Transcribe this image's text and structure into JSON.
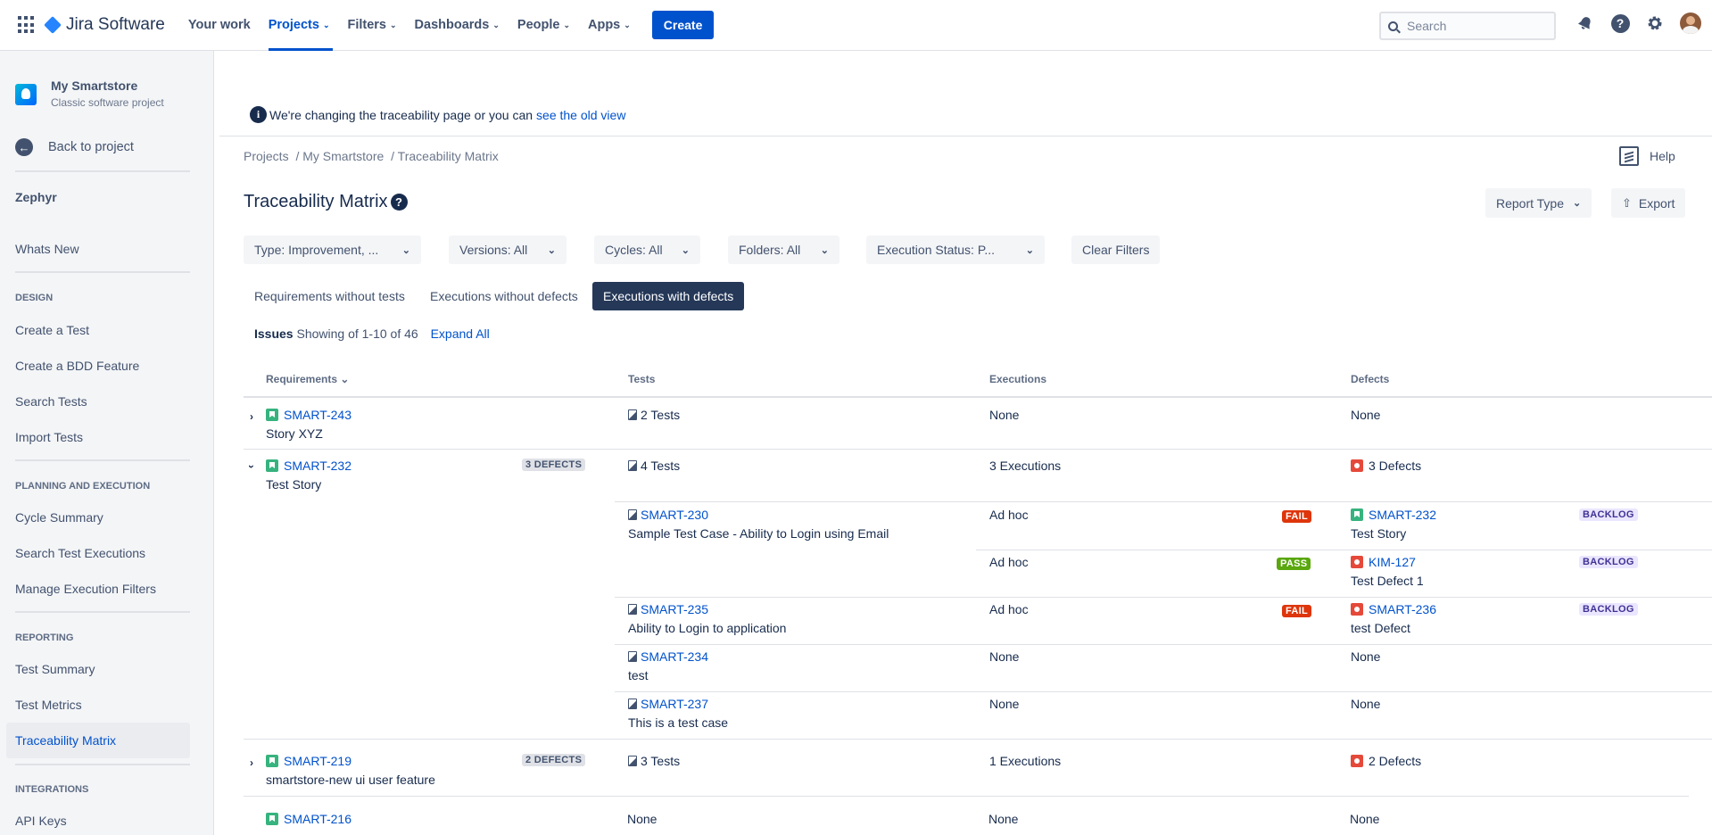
{
  "topnav": {
    "product": "Jira Software",
    "items": [
      {
        "label": "Your work",
        "chevron": false
      },
      {
        "label": "Projects",
        "chevron": true,
        "active": true
      },
      {
        "label": "Filters",
        "chevron": true
      },
      {
        "label": "Dashboards",
        "chevron": true
      },
      {
        "label": "People",
        "chevron": true
      },
      {
        "label": "Apps",
        "chevron": true
      }
    ],
    "create": "Create",
    "search_placeholder": "Search"
  },
  "sidebar": {
    "project_name": "My Smartstore",
    "project_type": "Classic software project",
    "back": "Back to project",
    "app": "Zephyr",
    "whats_new": "Whats New",
    "design": "DESIGN",
    "create_test": "Create a Test",
    "create_bdd": "Create a BDD Feature",
    "search_tests": "Search Tests",
    "import_tests": "Import Tests",
    "planning": "PLANNING AND EXECUTION",
    "cycle_summary": "Cycle Summary",
    "search_exec": "Search Test Executions",
    "manage_filters": "Manage Execution Filters",
    "reporting": "REPORTING",
    "test_summary": "Test Summary",
    "test_metrics": "Test Metrics",
    "traceability": "Traceability Matrix",
    "integrations": "INTEGRATIONS",
    "api_keys": "API Keys"
  },
  "banner": {
    "text": "We're changing the traceability page or you can",
    "link": "see the old view"
  },
  "breadcrumb": {
    "a": "Projects",
    "b": "/ My Smartstore",
    "c": "/ Traceability Matrix"
  },
  "help": "Help",
  "title": "Traceability Matrix",
  "report_type": "Report Type",
  "export": "Export",
  "filters": {
    "type": "Type: Improvement, ...",
    "versions": "Versions: All",
    "cycles": "Cycles: All",
    "folders": "Folders: All",
    "status": "Execution Status: P...",
    "clear": "Clear Filters"
  },
  "tabs": {
    "t1": "Requirements without tests",
    "t2": "Executions without defects",
    "t3": "Executions with defects"
  },
  "issues": {
    "label": "Issues",
    "showing": "Showing of 1-10 of 46",
    "expand": "Expand All"
  },
  "columns": {
    "req": "Requirements",
    "tests": "Tests",
    "exec": "Executions",
    "defects": "Defects"
  },
  "rows": {
    "r1": {
      "key": "SMART-243",
      "summary": "Story XYZ",
      "tests": "2 Tests",
      "exec": "None",
      "defects": "None"
    },
    "r2": {
      "key": "SMART-232",
      "summary": "Test Story",
      "badge": "3 DEFECTS",
      "tests": "4 Tests",
      "exec": "3 Executions",
      "defects": "3 Defects",
      "children": {
        "c1": {
          "key": "SMART-230",
          "summary": "Sample Test Case - Ability to Login using Email",
          "e1": "Ad hoc",
          "s1": "FAIL",
          "d1key": "SMART-232",
          "d1sum": "Test Story",
          "d1status": "BACKLOG",
          "e2": "Ad hoc",
          "s2": "PASS",
          "d2key": "KIM-127",
          "d2sum": "Test Defect 1",
          "d2status": "BACKLOG"
        },
        "c2": {
          "key": "SMART-235",
          "summary": "Ability to Login to application",
          "e1": "Ad hoc",
          "s1": "FAIL",
          "d1key": "SMART-236",
          "d1sum": "test Defect",
          "d1status": "BACKLOG"
        },
        "c3": {
          "key": "SMART-234",
          "summary": "test",
          "exec": "None",
          "defects": "None"
        },
        "c4": {
          "key": "SMART-237",
          "summary": "This is a test case",
          "exec": "None",
          "defects": "None"
        }
      }
    },
    "r3": {
      "key": "SMART-219",
      "summary": "smartstore-new ui user feature",
      "badge": "2 DEFECTS",
      "tests": "3 Tests",
      "exec": "1 Executions",
      "defects": "2 Defects"
    },
    "r4": {
      "key": "SMART-216",
      "tests": "None",
      "exec": "None",
      "defects": "None"
    }
  },
  "colors": {
    "primary": "#0052cc",
    "fail": "#de350b",
    "pass": "#5aa70e",
    "story": "#36b37e",
    "bug": "#e5493a"
  }
}
